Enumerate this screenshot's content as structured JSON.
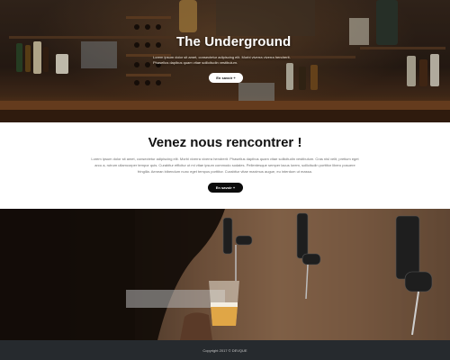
{
  "hero": {
    "title": "The Underground",
    "text": "Lorem ipsum dolor sit amet, consectetur adipiscing elit. Morbi viverra viverra hendrerit. Phasellus dapibus quam vitae sollicitudin vestibulum.",
    "button_label": "En savoir +"
  },
  "meet": {
    "title": "Venez nous rencontrer !",
    "text": "Lorem ipsum dolor sit amet, consectetur adipiscing elit. Morbi viverra viverra hendrerit. Phasellus dapibus quam vitae sollicitudin vestibulum. Cras nisl velit, pretium eget arcu a, rutrum ullamcorper tempor quis. Curabitur efficitur ut mi vitae ipsum commodo sodales. Pellentesque semper lacus lorem, sollicitudin porttitor libero posuere fringilla. Aenean bibendum nunc eget tempus porttitor. Curabitur vitae maximus augue, eu interdum ut massa.",
    "button_label": "En savoir +"
  },
  "footer": {
    "copyright": "Copyright 2017 © DEVQUE"
  },
  "colors": {
    "dark_button": "#0b0b0b",
    "footer_bg": "#262a2e",
    "bar_wood": "#6b3f1f"
  }
}
